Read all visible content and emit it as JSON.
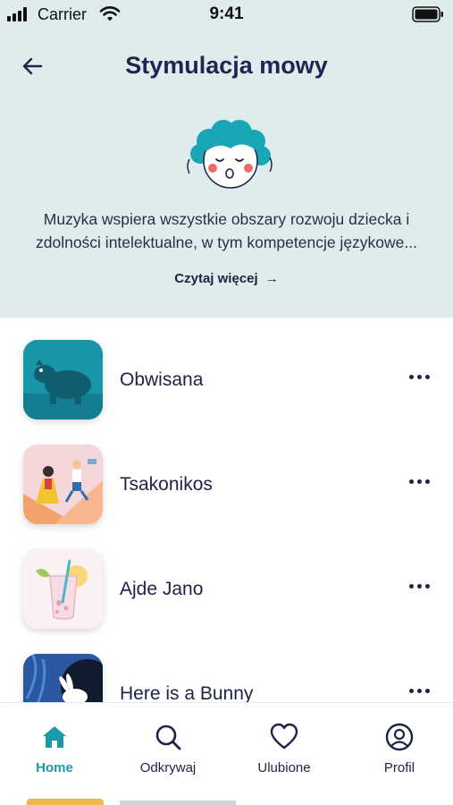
{
  "status_bar": {
    "carrier": "Carrier",
    "time": "9:41"
  },
  "header": {
    "title": "Stymulacja mowy",
    "description": "Muzyka wspiera wszystkie obszary rozwoju dziecka i zdolności intelektualne, w tym kompetencje językowe...",
    "read_more_label": "Czytaj więcej",
    "background_color": "#deeceb"
  },
  "songs": [
    {
      "title": "Obwisana",
      "thumbnail_icon": "hippo-illustration"
    },
    {
      "title": "Tsakonikos",
      "thumbnail_icon": "dancers-illustration"
    },
    {
      "title": "Ajde Jano",
      "thumbnail_icon": "drink-glass-illustration"
    },
    {
      "title": "Here is a Bunny",
      "thumbnail_icon": "bunny-illustration"
    }
  ],
  "tabbar": {
    "active_color": "#1a9aa6",
    "tabs": [
      {
        "label": "Home",
        "icon": "home-icon",
        "active": true
      },
      {
        "label": "Odkrywaj",
        "icon": "search-icon",
        "active": false
      },
      {
        "label": "Ulubione",
        "icon": "heart-icon",
        "active": false
      },
      {
        "label": "Profil",
        "icon": "profile-icon",
        "active": false
      }
    ]
  }
}
